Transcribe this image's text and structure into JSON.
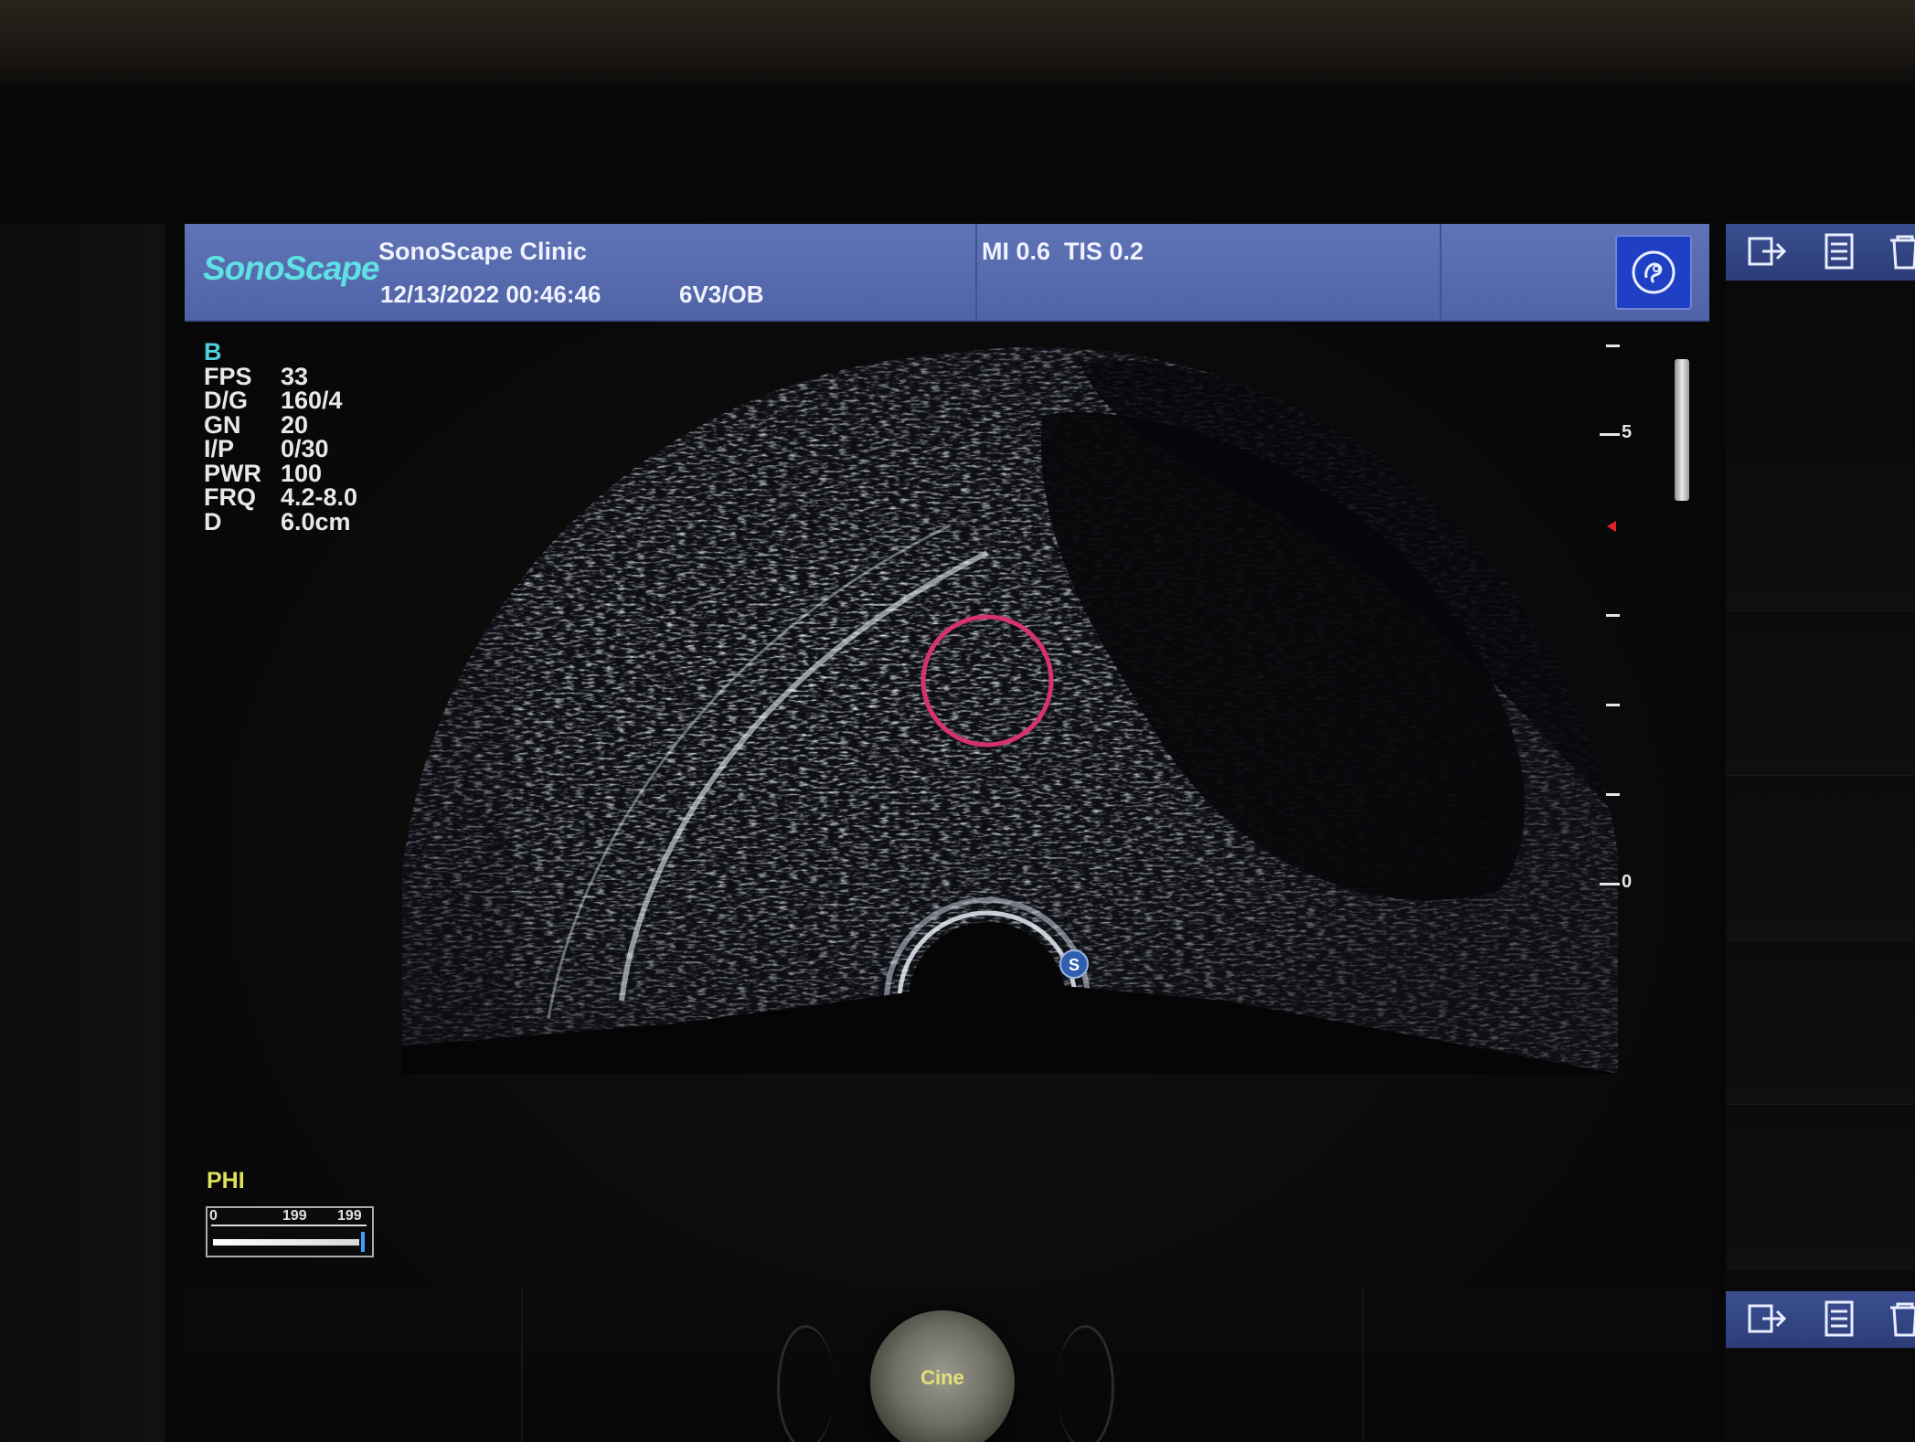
{
  "header": {
    "logo": "SonoScape",
    "clinic": "SonoScape Clinic",
    "datetime": "12/13/2022 00:46:46",
    "probe": "6V3/OB",
    "mi_tis": "MI 0.6  TIS 0.2",
    "exam_icon": "fetus-icon"
  },
  "params": {
    "mode": "B",
    "rows": [
      {
        "key": "FPS",
        "value": "33"
      },
      {
        "key": "D/G",
        "value": "160/4"
      },
      {
        "key": "GN",
        "value": "20"
      },
      {
        "key": "I/P",
        "value": "0/30"
      },
      {
        "key": "PWR",
        "value": "100"
      },
      {
        "key": "FRQ",
        "value": "4.2-8.0"
      },
      {
        "key": "D",
        "value": "6.0cm"
      }
    ]
  },
  "depth_scale": {
    "labels": [
      "5",
      "0"
    ]
  },
  "image": {
    "orientation_marker": "S",
    "annotation_color": "#d6336c"
  },
  "phi": {
    "label": "PHI",
    "scale_min": "0",
    "scale_mid": "199",
    "scale_max": "199"
  },
  "sidebar": {
    "icons": [
      "export-icon",
      "report-icon",
      "delete-icon"
    ]
  },
  "cine": {
    "label": "Cine"
  },
  "colors": {
    "header_bg": "#5f74b6",
    "logo": "#5fe0e4",
    "mode": "#4fd0e0",
    "phi_label": "#e1e05a",
    "cine_label": "#e4e07a"
  }
}
